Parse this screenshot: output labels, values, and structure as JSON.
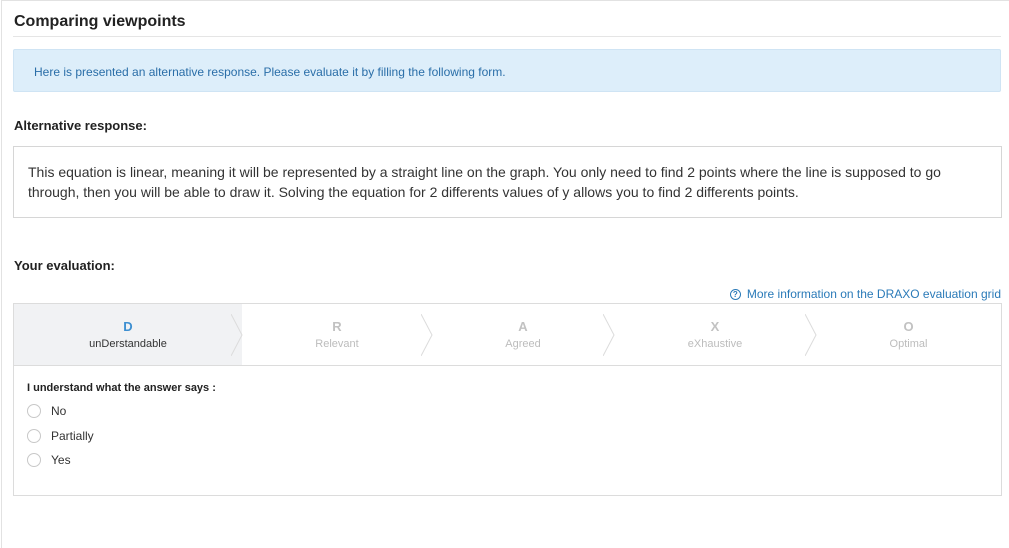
{
  "page": {
    "title": "Comparing viewpoints",
    "info_message": "Here is presented an alternative response. Please evaluate it by filling the following form."
  },
  "alternative": {
    "label": "Alternative response:",
    "text": "This equation is linear, meaning it will be represented by a straight line on the graph. You only need to find 2 points where the line is supposed to go through, then you will be able to draw it. Solving the equation for 2 differents values of y allows you to find 2 differents points."
  },
  "evaluation": {
    "label": "Your evaluation:",
    "more_info_link": "More information on the DRAXO evaluation grid",
    "help_icon": "question-circle-icon",
    "steps": [
      {
        "letter": "D",
        "label": "unDerstandable",
        "active": true
      },
      {
        "letter": "R",
        "label": "Relevant",
        "active": false
      },
      {
        "letter": "A",
        "label": "Agreed",
        "active": false
      },
      {
        "letter": "X",
        "label": "eXhaustive",
        "active": false
      },
      {
        "letter": "O",
        "label": "Optimal",
        "active": false
      }
    ],
    "question": "I understand what the answer says :",
    "options": [
      "No",
      "Partially",
      "Yes"
    ]
  },
  "colors": {
    "accent": "#3d8fd1",
    "info_background": "#ddeefa",
    "link": "#2a7ab8"
  }
}
